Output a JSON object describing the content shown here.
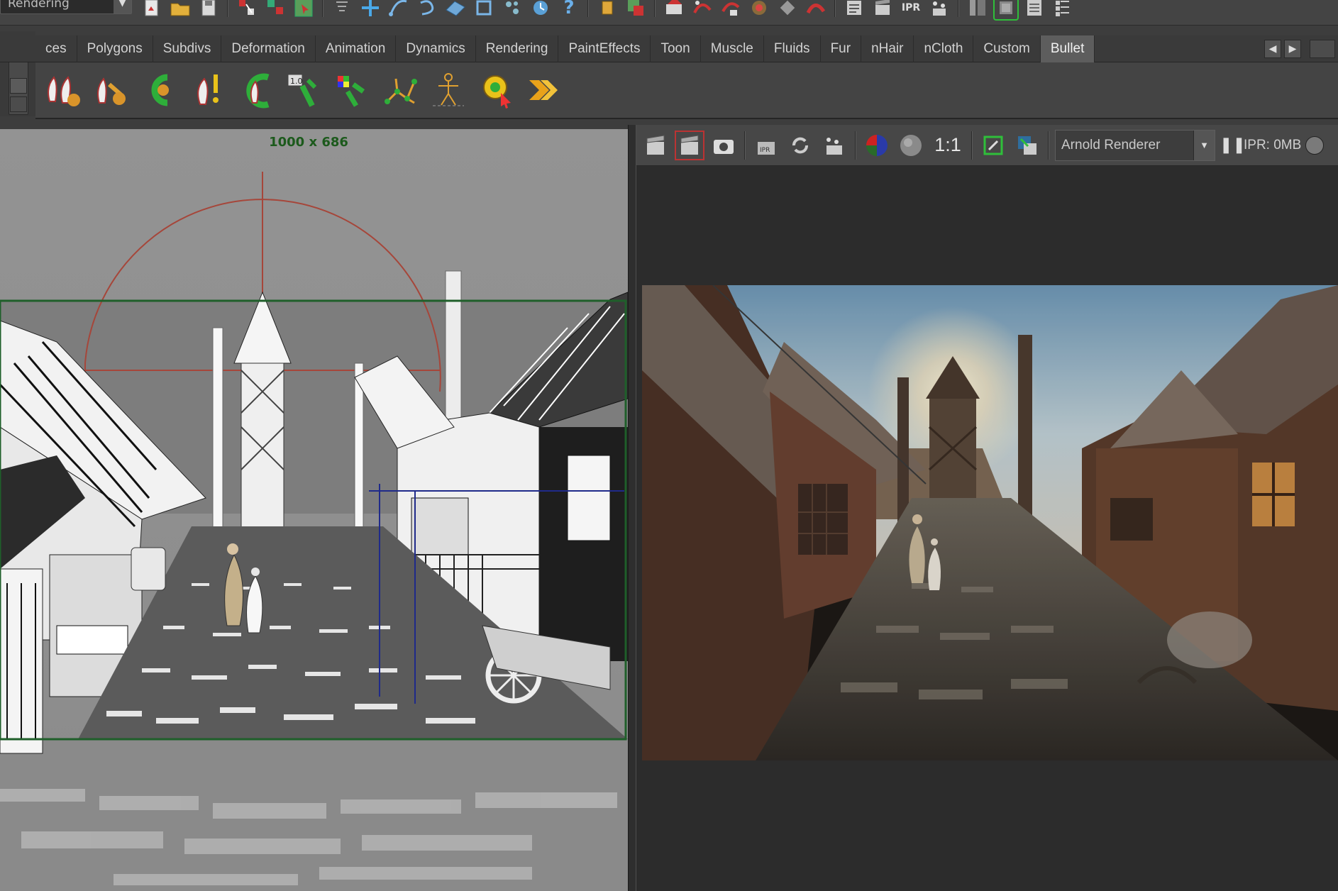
{
  "window": {
    "menu_set": "Rendering"
  },
  "status_line": {
    "icons": [
      "new-scene-icon",
      "open-scene-icon",
      "save-scene-icon",
      "select-hierarchy-icon",
      "select-object-icon",
      "select-component-icon",
      "filter-icon",
      "snap-grid-icon",
      "snap-curve-icon",
      "snap-point-icon",
      "snap-surface-icon",
      "snap-view-icon",
      "make-live-icon",
      "history-icon",
      "help-icon",
      "input-ops-icon",
      "output-ops-icon",
      "construction-history-icon",
      "render-current-icon",
      "ipr-render-icon",
      "render-settings-icon",
      "hypershade-icon",
      "render-view-icon",
      "sidebar-toggle-icon"
    ]
  },
  "shelf": {
    "tabs": [
      {
        "label": "ces",
        "active": false
      },
      {
        "label": "Polygons",
        "active": false
      },
      {
        "label": "Subdivs",
        "active": false
      },
      {
        "label": "Deformation",
        "active": false
      },
      {
        "label": "Animation",
        "active": false
      },
      {
        "label": "Dynamics",
        "active": false
      },
      {
        "label": "Rendering",
        "active": false
      },
      {
        "label": "PaintEffects",
        "active": false
      },
      {
        "label": "Toon",
        "active": false
      },
      {
        "label": "Muscle",
        "active": false
      },
      {
        "label": "Fluids",
        "active": false
      },
      {
        "label": "Fur",
        "active": false
      },
      {
        "label": "nHair",
        "active": false
      },
      {
        "label": "nCloth",
        "active": false
      },
      {
        "label": "Custom",
        "active": false
      },
      {
        "label": "Bullet",
        "active": true
      }
    ],
    "tools": [
      "rigid-body-icon",
      "rigid-set-icon",
      "soft-body-icon",
      "passive-body-icon",
      "ragdoll-icon",
      "constraint-icon",
      "cloth-icon",
      "fracture-icon",
      "skeleton-icon",
      "simulate-icon",
      "play-sim-icon"
    ]
  },
  "viewport": {
    "resolution_gate_label": "1000 x 686"
  },
  "render_view": {
    "ratio_label": "1:1",
    "renderer": "Arnold Renderer",
    "ipr_status": "IPR: 0MB"
  },
  "colors": {
    "active_tab": "#5d5d5d",
    "resolution_gate": "#1f5f2a",
    "camera_gizmo": "#a6463a"
  }
}
